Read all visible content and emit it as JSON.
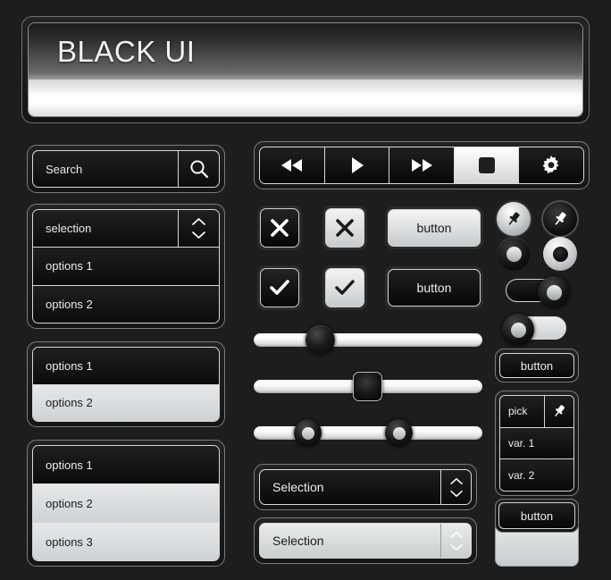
{
  "header": {
    "title": "BLACK UI"
  },
  "search": {
    "value": "Search",
    "placeholder": "Search",
    "icon": "search-icon"
  },
  "dropdown": {
    "selected": "selection",
    "options": [
      "options 1",
      "options 2"
    ],
    "spinner_up_icon": "chevron-up-icon",
    "spinner_down_icon": "chevron-down-icon"
  },
  "list_two": {
    "items": [
      {
        "label": "options 1",
        "state": "dark"
      },
      {
        "label": "options 2",
        "state": "light"
      }
    ]
  },
  "list_three": {
    "items": [
      {
        "label": "options 1",
        "state": "dark"
      },
      {
        "label": "options 2",
        "state": "light"
      },
      {
        "label": "options 3",
        "state": "light"
      }
    ]
  },
  "toolbar": {
    "buttons": [
      {
        "name": "rewind-button",
        "icon": "rewind-icon",
        "active": false
      },
      {
        "name": "play-button",
        "icon": "play-icon",
        "active": false
      },
      {
        "name": "fast-forward-button",
        "icon": "fast-forward-icon",
        "active": false
      },
      {
        "name": "stop-button",
        "icon": "stop-icon",
        "active": true
      },
      {
        "name": "settings-button",
        "icon": "gear-icon",
        "active": false
      }
    ]
  },
  "controls": {
    "close_dark_icon": "close-x-icon",
    "close_light_icon": "close-x-icon",
    "check_dark_icon": "check-icon",
    "check_light_icon": "check-icon",
    "button_light_label": "button",
    "button_dark_label": "button"
  },
  "sliders": [
    {
      "name": "slider-round-knob",
      "value": 27,
      "knob": "round"
    },
    {
      "name": "slider-square-knob",
      "value": 50,
      "knob": "square"
    },
    {
      "name": "slider-range",
      "value_low": 22,
      "value_high": 62,
      "knob": "donut"
    }
  ],
  "selection_boxes": [
    {
      "label": "Selection",
      "state": "dark"
    },
    {
      "label": "Selection",
      "state": "light"
    }
  ],
  "right_column": {
    "pin_light_icon": "pushpin-icon",
    "pin_dark_icon": "pushpin-icon",
    "radio_dark_name": "radio-button-dark",
    "radio_light_name": "radio-button-light",
    "toggle_on_state": "on",
    "toggle_off_state": "off",
    "button_label": "button",
    "pick": {
      "header": "pick",
      "pin_icon": "pushpin-icon",
      "items": [
        "var. 1",
        "var. 2"
      ]
    },
    "bottom_button_label": "button"
  },
  "colors": {
    "page_background": "#1d1d1d",
    "panel_dark": "#151515",
    "panel_light": "#d3d5d7",
    "border_light": "#d9d9d9",
    "text_light": "#ededed",
    "text_dark": "#1b1b1b"
  }
}
